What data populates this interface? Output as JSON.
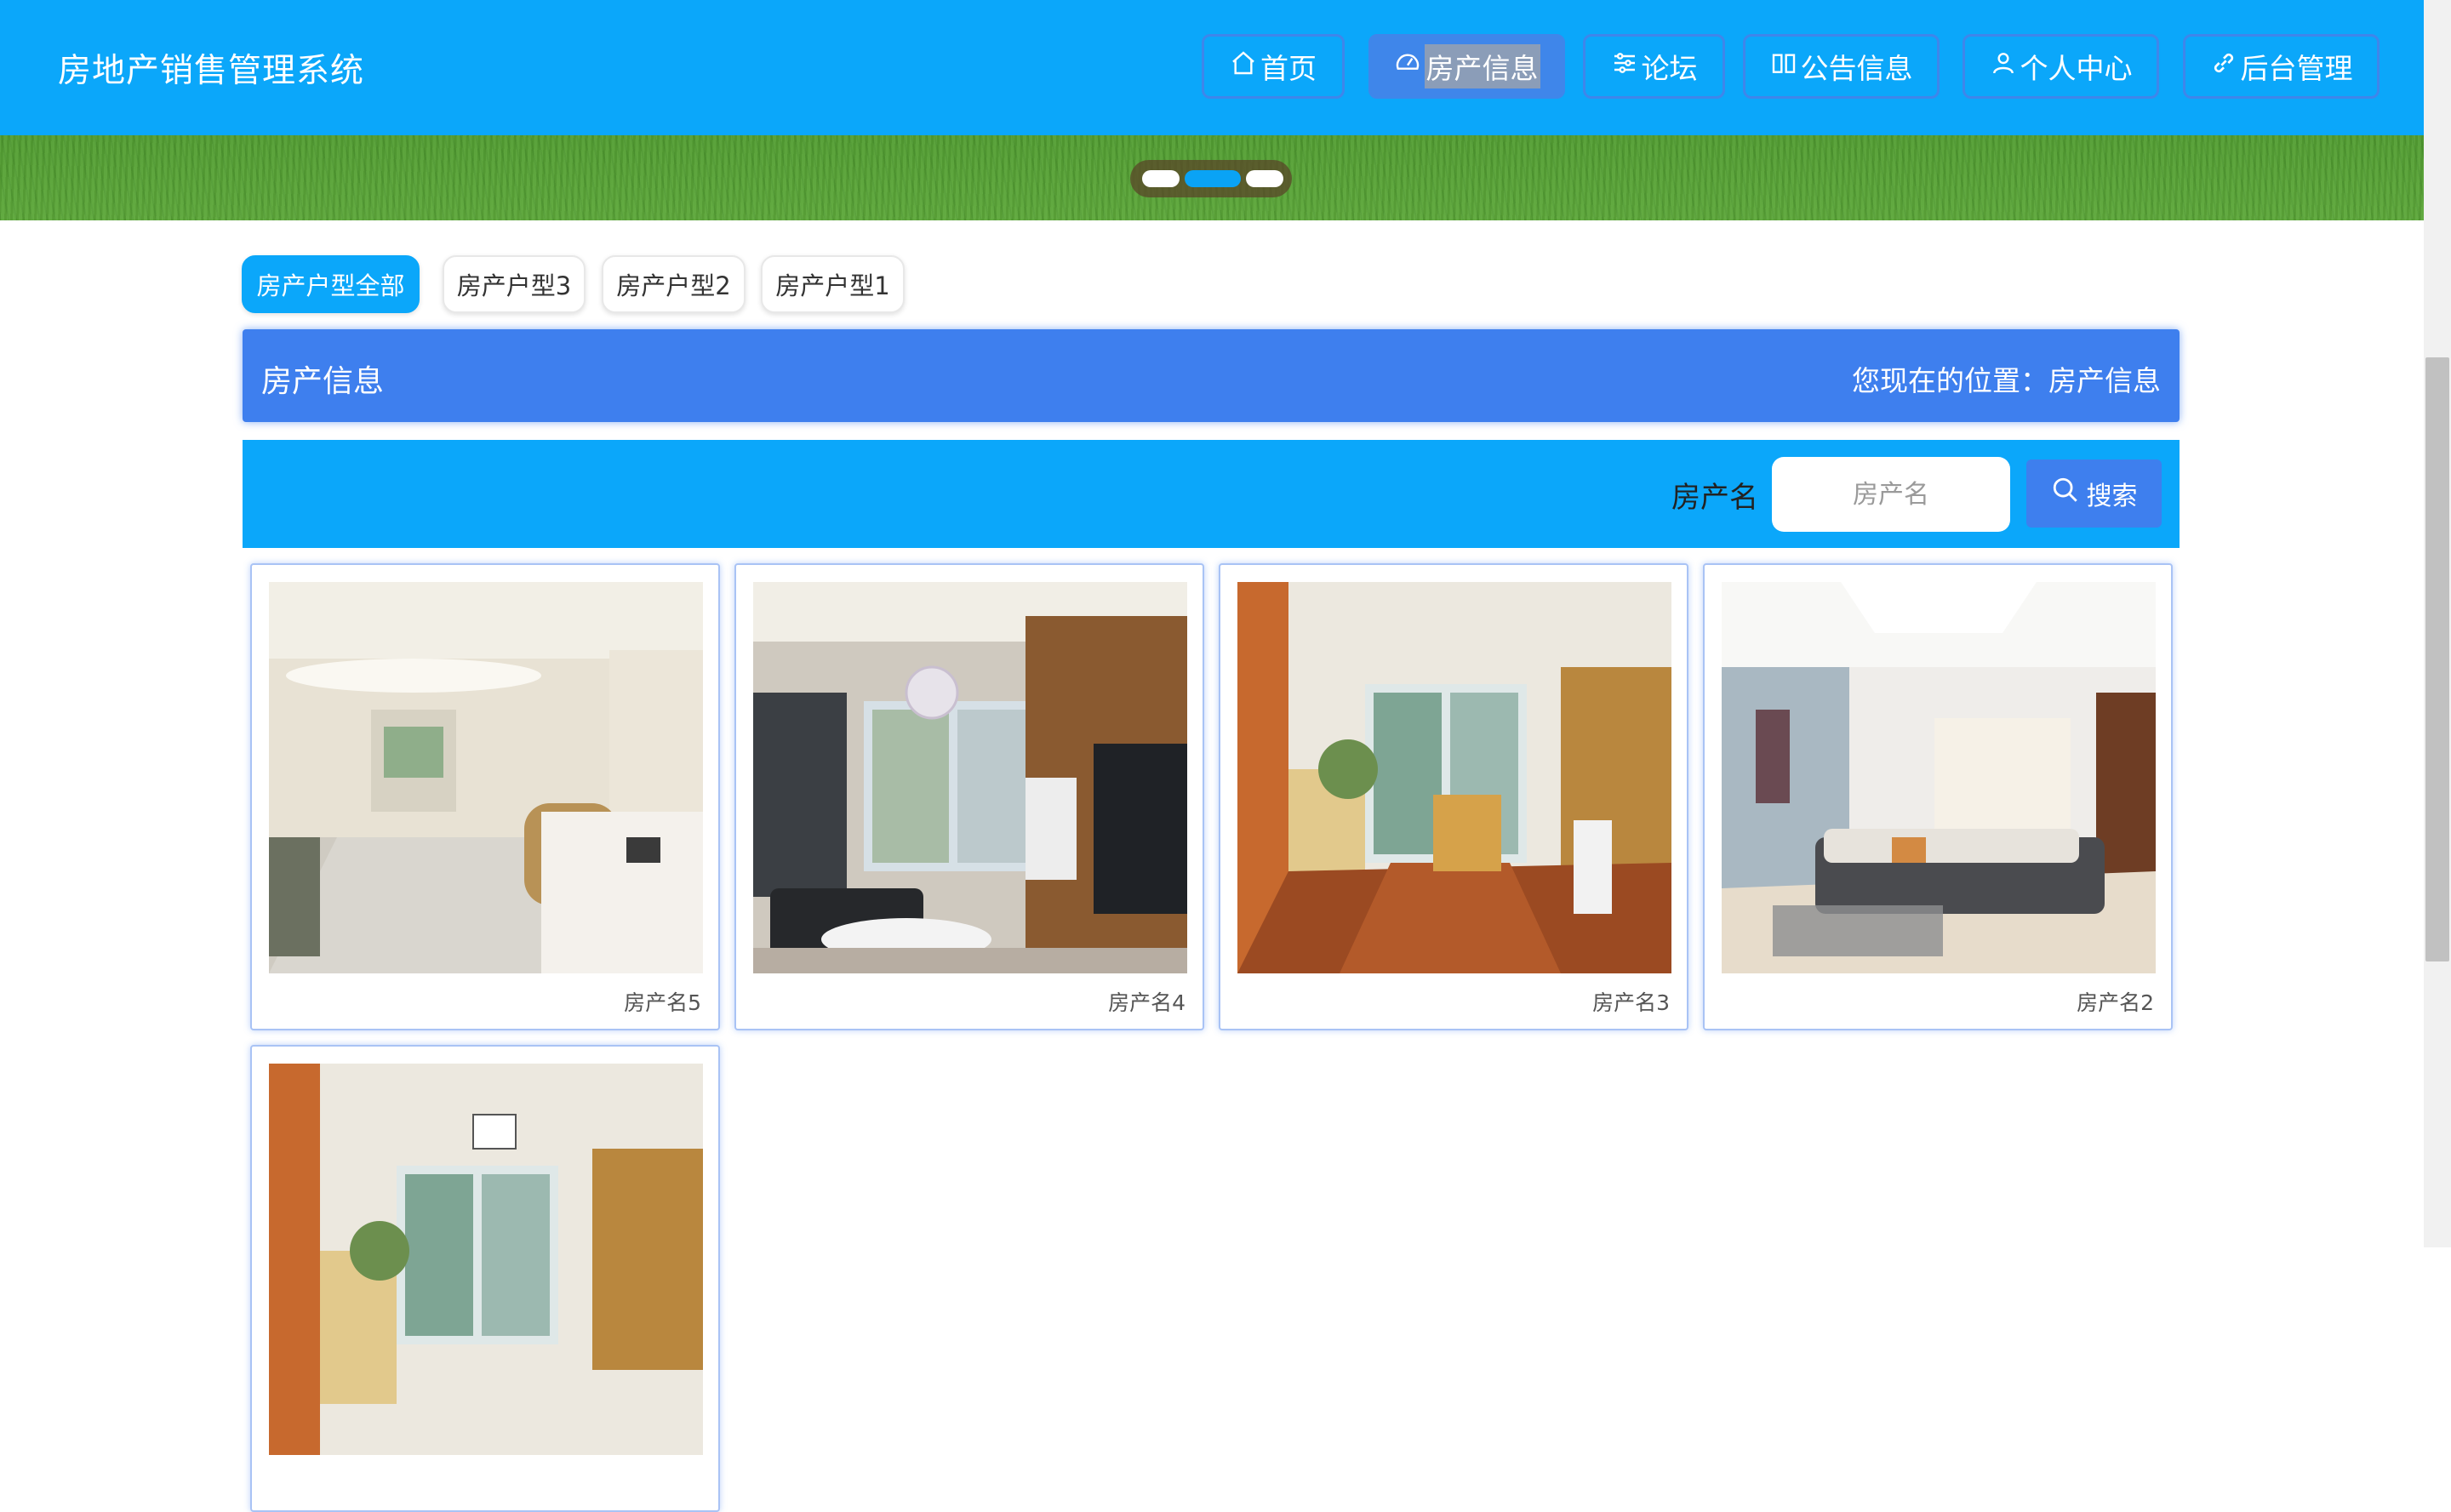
{
  "header": {
    "brand": "房地产销售管理系统",
    "nav": [
      {
        "label": "首页",
        "icon": "home-icon"
      },
      {
        "label": "房产信息",
        "icon": "gauge-icon",
        "active": true
      },
      {
        "label": "论坛",
        "icon": "sliders-icon"
      },
      {
        "label": "公告信息",
        "icon": "book-icon"
      },
      {
        "label": "个人中心",
        "icon": "user-icon"
      },
      {
        "label": "后台管理",
        "icon": "link-icon"
      }
    ],
    "accent": "#0ba7fa",
    "nav_active_color": "#3e7fee"
  },
  "carousel": {
    "slides": 3,
    "active_index": 1
  },
  "categories": [
    {
      "label": "房产户型全部",
      "active": true
    },
    {
      "label": "房产户型3"
    },
    {
      "label": "房产户型2"
    },
    {
      "label": "房产户型1"
    }
  ],
  "titlebar": {
    "title": "房产信息",
    "location": "您现在的位置：房产信息"
  },
  "search": {
    "label": "房产名",
    "placeholder": "房产名",
    "value": "",
    "button": "搜索"
  },
  "listings": [
    {
      "name": "房产名5",
      "image": "living-room-with-rattan-chair"
    },
    {
      "name": "房产名4",
      "image": "living-room-with-chandelier"
    },
    {
      "name": "房产名3",
      "image": "dining-room-wood-floor"
    },
    {
      "name": "房产名2",
      "image": "bright-living-room-sofa"
    },
    {
      "name": "",
      "image": "dining-room-wood-floor"
    }
  ]
}
